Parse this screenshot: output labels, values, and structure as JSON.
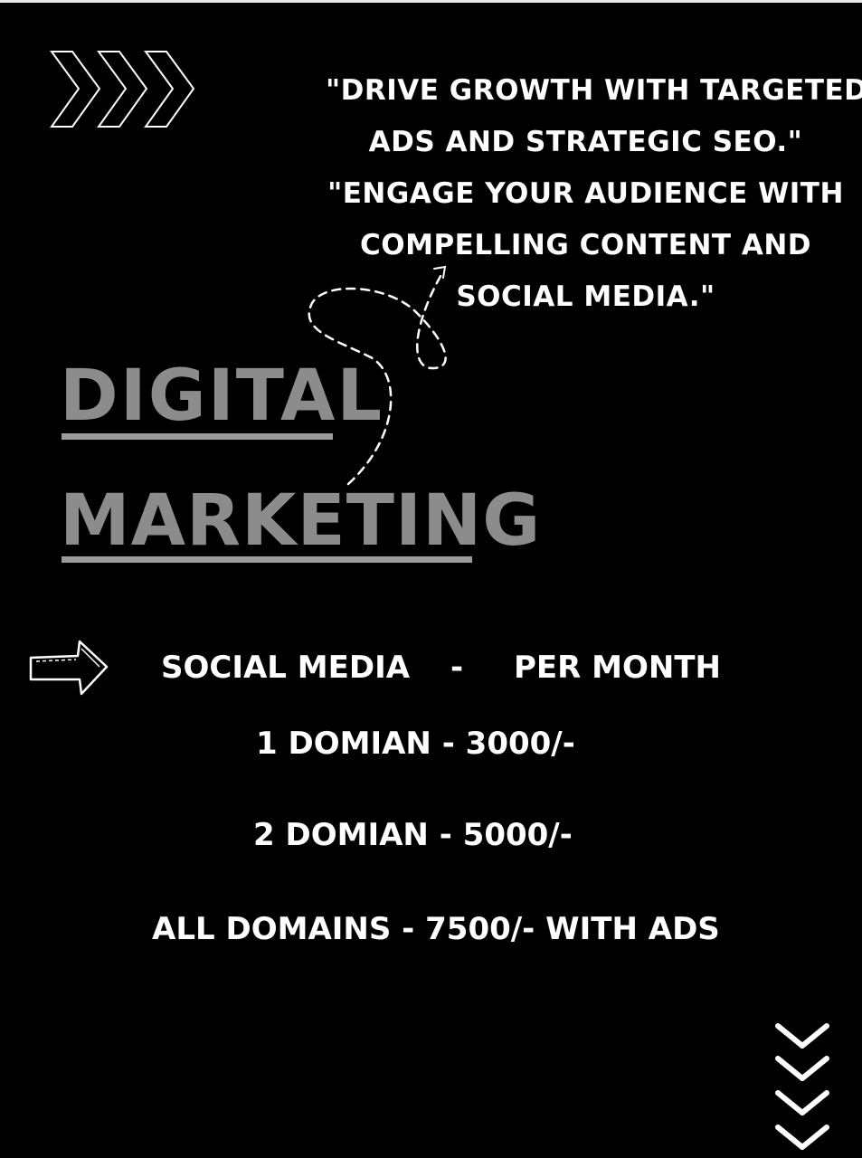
{
  "quote": {
    "lines": [
      "\"DRIVE GROWTH WITH TARGETED",
      "ADS AND STRATEGIC SEO.\"",
      "\"ENGAGE YOUR AUDIENCE WITH",
      "COMPELLING CONTENT AND",
      "SOCIAL MEDIA.\""
    ]
  },
  "title": {
    "line1": "DIGITAL",
    "line2": "MARKETING"
  },
  "pricing": {
    "header": {
      "service": "SOCIAL MEDIA",
      "separator": "-",
      "period": "PER MONTH"
    },
    "rows": [
      "1 DOMIAN - 3000/-",
      "2 DOMIAN - 5000/-",
      "ALL DOMAINS - 7500/- WITH ADS"
    ]
  },
  "icons": {
    "top_left": "chevrons-right-icon",
    "squiggle": "dashed-curly-arrow-icon",
    "pointer": "hand-drawn-arrow-right-icon",
    "bottom_right": "chevrons-down-icon"
  },
  "colors": {
    "background": "#000000",
    "text": "#ffffff",
    "title": "#8c8c8c"
  }
}
